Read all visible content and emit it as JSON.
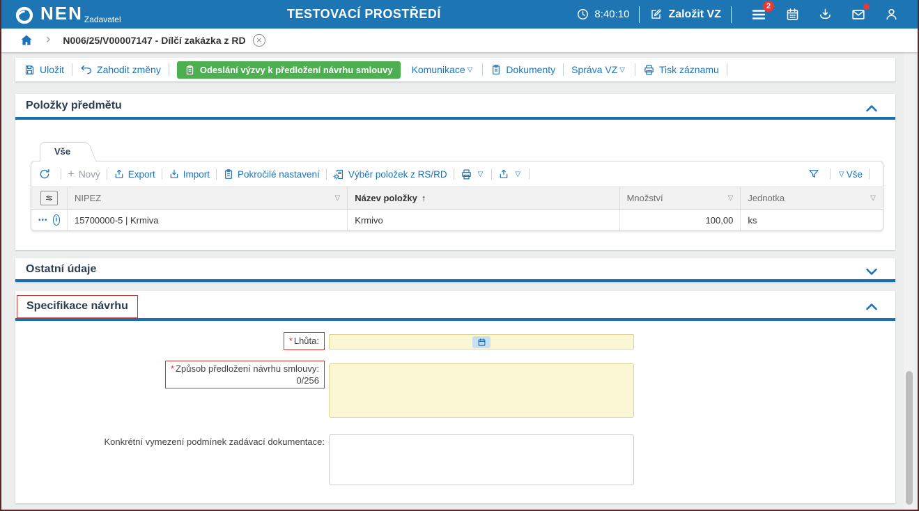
{
  "header": {
    "brand": "NEN",
    "brand_subtitle": "Zadavatel",
    "environment_title": "TESTOVACÍ PROSTŘEDÍ",
    "time": "8:40:10",
    "create_vz_label": "Založit VZ",
    "menu_badge_count": "2"
  },
  "breadcrumb": {
    "item_label": "N006/25/V00007147 - Dílčí zakázka z RD"
  },
  "action_toolbar": {
    "save": "Uložit",
    "discard": "Zahodit změny",
    "send_proposal": "Odeslání výzvy k předložení návrhu smlouvy",
    "communication": "Komunikace",
    "documents": "Dokumenty",
    "manage_vz": "Správa VZ",
    "print_record": "Tisk záznamu"
  },
  "items_section": {
    "title": "Položky předmětu",
    "tab_all": "Vše",
    "grid_toolbar": {
      "new": "Nový",
      "export": "Export",
      "import": "Import",
      "advanced_settings": "Pokročilé nastavení",
      "select_from_rs_rd": "Výběr položek z RS/RD",
      "filter_all": "Vše"
    },
    "table": {
      "columns": [
        "NIPEZ",
        "Název položky",
        "Množství",
        "Jednotka"
      ],
      "rows": [
        {
          "nipez": "15700000-5 | Krmiva",
          "nazev": "Krmivo",
          "mnozstvi": "100,00",
          "jednotka": "ks"
        }
      ]
    }
  },
  "other_section": {
    "title": "Ostatní údaje"
  },
  "spec_section": {
    "title": "Specifikace návrhu",
    "deadline_label": "Lhůta:",
    "method_label": "Způsob předložení návrhu smlouvy:",
    "method_counter": "0/256",
    "conditions_label": "Konkrétní vymezení podmínek zadávací dokumentace:"
  },
  "icons": {
    "dropdown": "▽",
    "sort_asc": "↑",
    "breadcrumb_chevron": "›",
    "close": "×",
    "row_actions": "•••",
    "info": "i",
    "required_asterisk": "*",
    "plus": "+"
  },
  "colors": {
    "header_blue": "#1e75b4",
    "link_blue": "#1b74bb",
    "accent_green": "#4caf50",
    "required_red": "#c9352c",
    "required_field_bg": "#fbf7d5",
    "section_underline": "#1a70ae"
  }
}
